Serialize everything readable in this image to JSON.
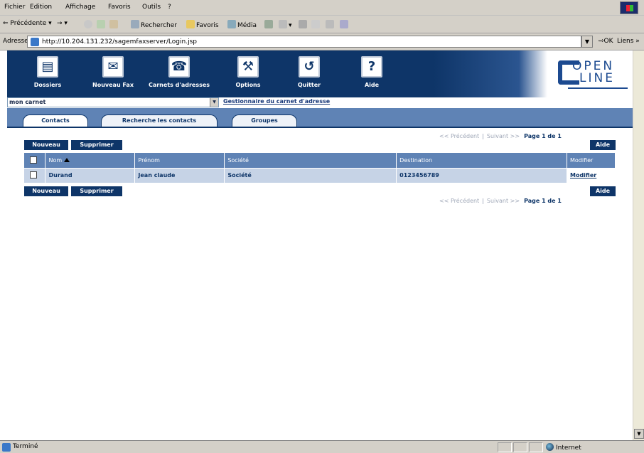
{
  "browser": {
    "menu": [
      "Fichier",
      "Edition",
      "Affichage",
      "Favoris",
      "Outils",
      "?"
    ],
    "toolbar": {
      "back": "Précédente",
      "forward": "→",
      "search": "Rechercher",
      "favorites": "Favoris",
      "media": "Média"
    },
    "address": {
      "label": "Adresse",
      "url": "http://10.204.131.232/sagemfaxserver/Login.jsp",
      "go": "OK",
      "links": "Liens »"
    },
    "status": {
      "text": "Terminé",
      "zone": "Internet"
    }
  },
  "app": {
    "nav": [
      {
        "label": "Dossiers",
        "icon": "folder-icon"
      },
      {
        "label": "Nouveau Fax",
        "icon": "fax-icon"
      },
      {
        "label": "Carnets d'adresses",
        "icon": "phone-icon"
      },
      {
        "label": "Options",
        "icon": "wrench-icon"
      },
      {
        "label": "Quitter",
        "icon": "exit-icon"
      },
      {
        "label": "Aide",
        "icon": "help-icon"
      }
    ],
    "logo": {
      "line1": "OPEN",
      "line2": "LINE"
    },
    "carnet_select": "mon carnet",
    "breadcrumb": "Gestionnaire du carnet d'adresse",
    "tabs": [
      "Contacts",
      "Recherche les contacts",
      "Groupes"
    ],
    "active_tab": "Contacts",
    "buttons": {
      "new": "Nouveau",
      "delete": "Supprimer",
      "help": "Aide"
    },
    "pager": {
      "prev": "<< Précédent",
      "next": "Suivant >>",
      "page": "Page 1 de 1"
    },
    "table": {
      "columns": [
        "Nom",
        "Prénom",
        "Société",
        "Destination",
        "Modifier"
      ],
      "rows": [
        {
          "nom": "Durand",
          "prenom": "Jean claude",
          "societe": "Société",
          "destination": "0123456789",
          "modifier": "Modifier"
        }
      ]
    },
    "colors": {
      "header": "#0e3568",
      "band": "#5f83b5",
      "row": "#c6d3e6"
    }
  }
}
